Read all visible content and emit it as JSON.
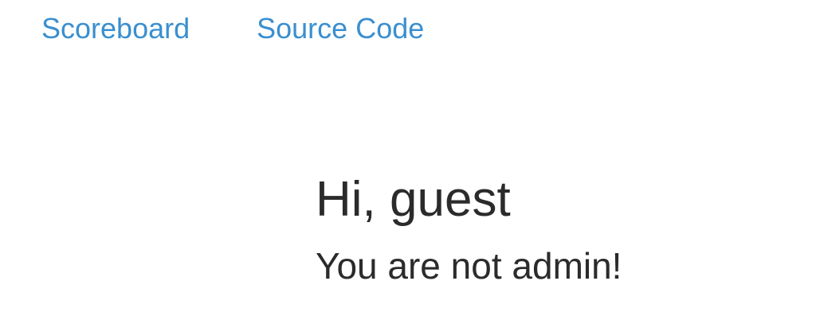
{
  "nav": {
    "links": [
      {
        "label": "Scoreboard"
      },
      {
        "label": "Source Code"
      }
    ]
  },
  "main": {
    "greeting": "Hi, guest",
    "message": "You are not admin!"
  },
  "colors": {
    "link": "#3a8fcf",
    "text": "#2b2b2b",
    "background": "#ffffff"
  }
}
